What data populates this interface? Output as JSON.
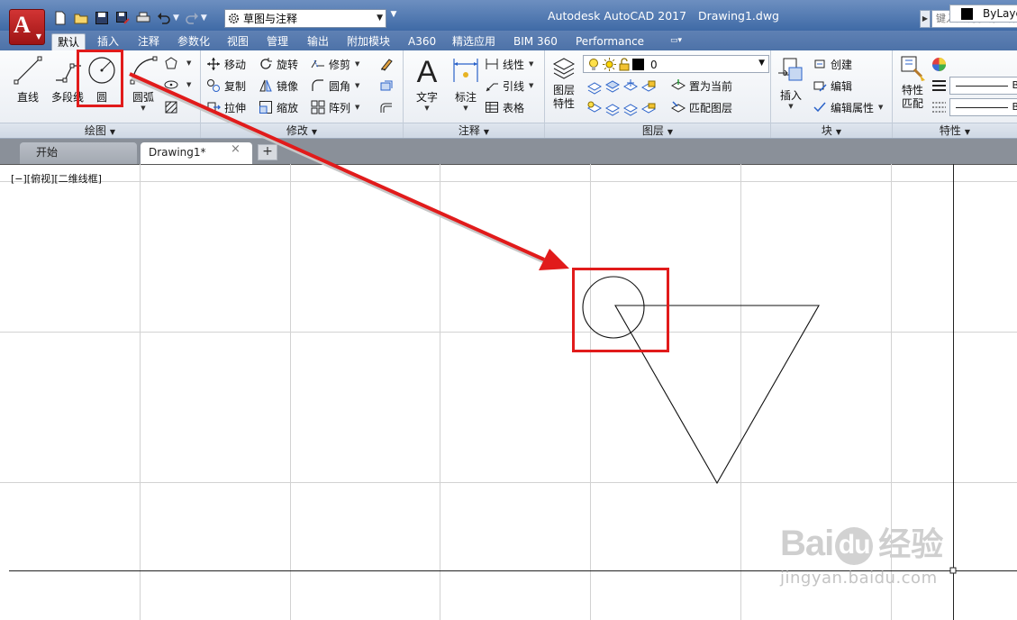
{
  "window": {
    "app_title": "Autodesk AutoCAD 2017",
    "drawing_title": "Drawing1.dwg",
    "logo_letter": "A",
    "workspace": "草图与注释",
    "search_placeholder": "键入关键字或短语"
  },
  "ribbon": {
    "tabs": [
      {
        "label": "默认",
        "active": true
      },
      {
        "label": "插入"
      },
      {
        "label": "注释"
      },
      {
        "label": "参数化"
      },
      {
        "label": "视图"
      },
      {
        "label": "管理"
      },
      {
        "label": "输出"
      },
      {
        "label": "附加模块"
      },
      {
        "label": "A360"
      },
      {
        "label": "精选应用"
      },
      {
        "label": "BIM 360"
      },
      {
        "label": "Performance"
      }
    ],
    "draw": {
      "title": "绘图",
      "line": "直线",
      "polyline": "多段线",
      "circle": "圆",
      "arc": "圆弧"
    },
    "modify": {
      "title": "修改",
      "move": "移动",
      "rotate": "旋转",
      "trim": "修剪",
      "copy": "复制",
      "mirror": "镜像",
      "fillet": "圆角",
      "stretch": "拉伸",
      "scale": "缩放",
      "array": "阵列"
    },
    "annotation": {
      "title": "注释",
      "text": "文字",
      "dimension": "标注",
      "linear": "线性",
      "leader": "引线",
      "table": "表格"
    },
    "layers": {
      "title": "图层",
      "properties_line1": "图层",
      "properties_line2": "特性",
      "current_layer": "0",
      "set_current": "置为当前",
      "match_layer": "匹配图层"
    },
    "block": {
      "title": "块",
      "insert": "插入",
      "create": "创建",
      "edit": "编辑",
      "edit_attributes": "编辑属性"
    },
    "properties": {
      "title": "特性",
      "match_line1": "特性",
      "match_line2": "匹配",
      "color": "ByLayer",
      "linetype_suffix": "B",
      "lineweight_suffix": "B"
    }
  },
  "file_tabs": {
    "start": "开始",
    "drawing": "Drawing1*",
    "close_glyph": "×",
    "add_glyph": "+"
  },
  "viewport": {
    "controls": "[−][俯视][二维线框]"
  },
  "watermark": {
    "logo_left": "Bai",
    "logo_du": "du",
    "logo_cn": "经验",
    "url": "jingyan.baidu.com"
  },
  "colors": {
    "highlight_red": "#e11b1b",
    "titlebar": "#4d72a8",
    "grid": "#d2d2d2"
  }
}
